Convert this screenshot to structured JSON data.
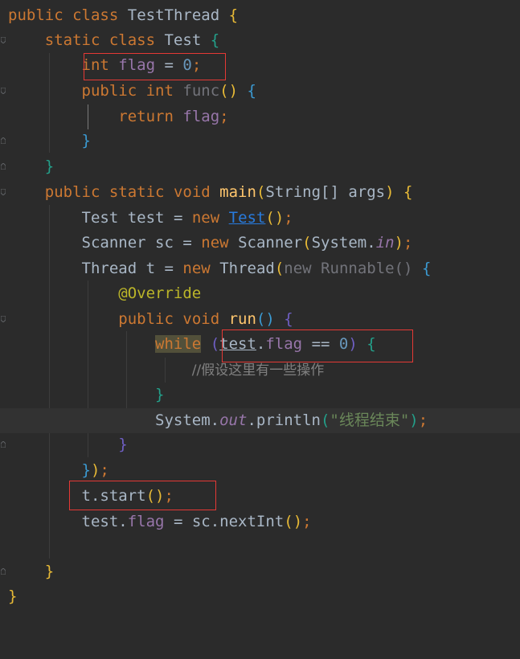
{
  "code": {
    "line1": {
      "kw1": "public",
      "kw2": "class",
      "name": "TestThread",
      "brace": "{"
    },
    "line2": {
      "kw1": "static",
      "kw2": "class",
      "name": "Test",
      "brace": "{"
    },
    "line3": {
      "type": "int",
      "field": "flag",
      "op": "=",
      "value": "0",
      "semi": ";"
    },
    "line4": {
      "kw1": "public",
      "kw2": "int",
      "method": "func",
      "parens": "()",
      "brace": "{"
    },
    "line5": {
      "kw": "return",
      "field": "flag",
      "semi": ";"
    },
    "line6": {
      "brace": "}"
    },
    "line7": {
      "brace": "}"
    },
    "line8": {
      "kw1": "public",
      "kw2": "static",
      "kw3": "void",
      "method": "main",
      "po": "(",
      "params": "String[] args",
      "pc": ")",
      "brace": "{"
    },
    "line9": {
      "type": "Test",
      "var": "test",
      "op": "=",
      "kw": "new",
      "ctor": "Test",
      "parens": "()",
      "semi": ";"
    },
    "line10": {
      "type": "Scanner",
      "var": "sc",
      "op": "=",
      "kw": "new",
      "ctor": "Scanner",
      "po": "(",
      "cls": "System.",
      "field": "in",
      "pc": ")",
      "semi": ";"
    },
    "line11": {
      "type": "Thread",
      "var": "t",
      "op": "=",
      "kw": "new",
      "ctor": "Thread",
      "po": "(",
      "kw2": "new",
      "anon": "Runnable",
      "parens": "()",
      "brace": "{"
    },
    "line12": {
      "annotation": "@Override"
    },
    "line13": {
      "kw1": "public",
      "kw2": "void",
      "method": "run",
      "parens": "()",
      "brace": "{"
    },
    "line14": {
      "kw": "while",
      "po": "(",
      "var": "test",
      "dot": ".",
      "field": "flag",
      "op": "==",
      "value": "0",
      "pc": ")",
      "brace": "{"
    },
    "line15": {
      "comment": "//假设这里有一些操作"
    },
    "line16": {
      "brace": "}"
    },
    "line17": {
      "cls": "System.",
      "field": "out",
      "call": ".println",
      "po": "(",
      "str": "\"线程结束\"",
      "pc": ")",
      "semi": ";"
    },
    "line18": {
      "brace": "}"
    },
    "line19": {
      "brace": "}",
      "pc": ")",
      "semi": ";"
    },
    "line20": {
      "var": "t",
      "call": ".start",
      "parens": "()",
      "semi": ";"
    },
    "line21": {
      "var": "test",
      "dot": ".",
      "field": "flag",
      "op": "=",
      "rhs": "sc.nextInt",
      "parens": "()",
      "semi": ";"
    },
    "line23": {
      "brace": "}"
    },
    "line24": {
      "brace": "}"
    }
  },
  "colors": {
    "background": "#2b2b2b",
    "keyword": "#cc7832",
    "method": "#ffc66d",
    "field": "#9876aa",
    "number": "#6897bb",
    "string": "#6a8759",
    "annotation": "#bbb529",
    "highlight_box": "#e53935"
  }
}
